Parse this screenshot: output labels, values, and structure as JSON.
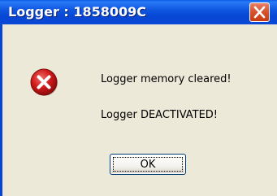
{
  "window": {
    "title": "Logger : 1858009C"
  },
  "dialog": {
    "icon": "error-icon",
    "messages": [
      "Logger memory cleared!",
      "Logger DEACTIVATED!"
    ],
    "ok_label": "OK"
  },
  "colors": {
    "titlebar": "#0746d4",
    "close_button": "#d9542f",
    "error_red": "#c1121f",
    "dialog_background": "#ece9d8"
  }
}
